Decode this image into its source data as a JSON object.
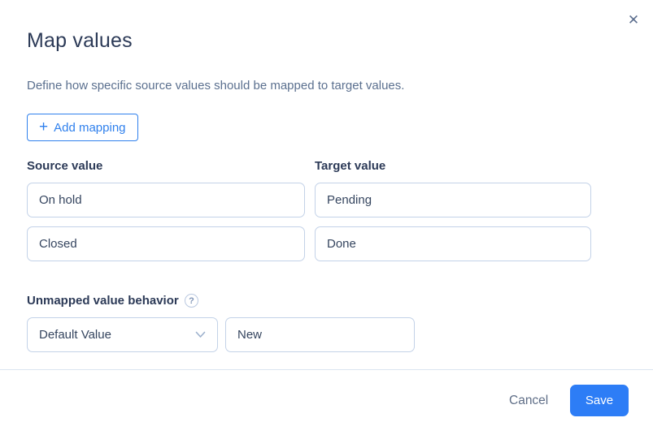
{
  "modal": {
    "title": "Map values",
    "description": "Define how specific source values should be mapped to target values.",
    "icons": {
      "close": "✕",
      "plus": "+",
      "help": "?"
    },
    "add_mapping_label": "Add mapping",
    "columns": {
      "source_label": "Source value",
      "target_label": "Target value"
    },
    "mappings": [
      {
        "source": "On hold",
        "target": "Pending"
      },
      {
        "source": "Closed",
        "target": "Done"
      }
    ],
    "unmapped": {
      "label": "Unmapped value behavior",
      "behavior_selected": "Default Value",
      "default_value": "New"
    },
    "footer": {
      "cancel_label": "Cancel",
      "save_label": "Save"
    },
    "colors": {
      "accent_blue": "#2f80ed",
      "save_button_blue": "#2d7df6",
      "title_text": "#2c3a57",
      "muted_text": "#5b708f",
      "input_border": "#c3d2e8",
      "divider": "#dbe5f1"
    }
  }
}
